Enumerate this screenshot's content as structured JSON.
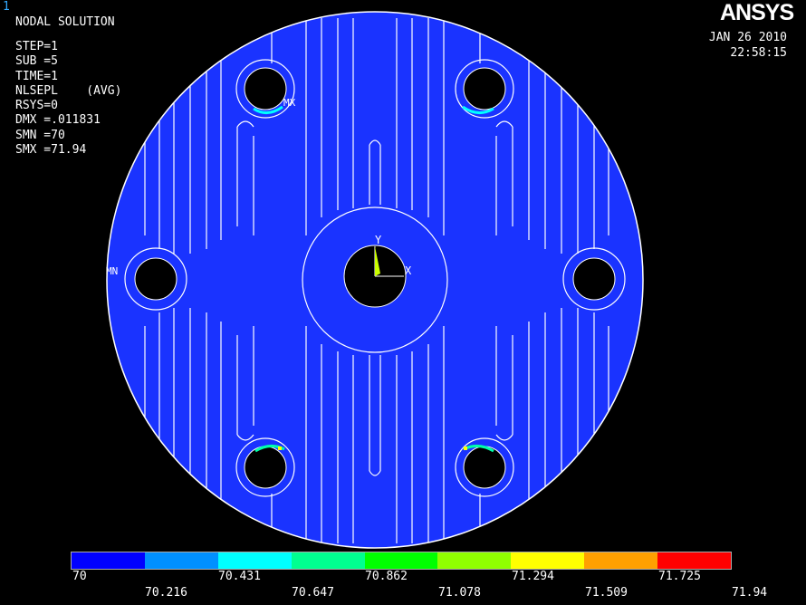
{
  "window_number": "1",
  "title": "NODAL SOLUTION",
  "info_lines": [
    "STEP=1",
    "SUB =5",
    "TIME=1",
    "NLSEPL    (AVG)",
    "RSYS=0",
    "DMX =.011831",
    "SMN =70",
    "SMX =71.94"
  ],
  "logo": "ANSYS",
  "date": "JAN 26 2010",
  "time": "22:58:15",
  "markers": {
    "max": "MX",
    "min": "MN",
    "axis_x": "X",
    "axis_y": "Y"
  },
  "legend": {
    "colors": [
      "#0000ff",
      "#0090ff",
      "#00ffff",
      "#00ff90",
      "#00ff00",
      "#90ff00",
      "#ffff00",
      "#ffa000",
      "#ff0000"
    ],
    "upper_labels": [
      "70",
      "70.431",
      "70.862",
      "71.294",
      "71.725"
    ],
    "lower_labels": [
      "70.216",
      "70.647",
      "71.078",
      "71.509",
      "71.94"
    ]
  },
  "colors": {
    "background": "#000000",
    "plate": "#1a33ff",
    "contour": "#ffffff"
  }
}
